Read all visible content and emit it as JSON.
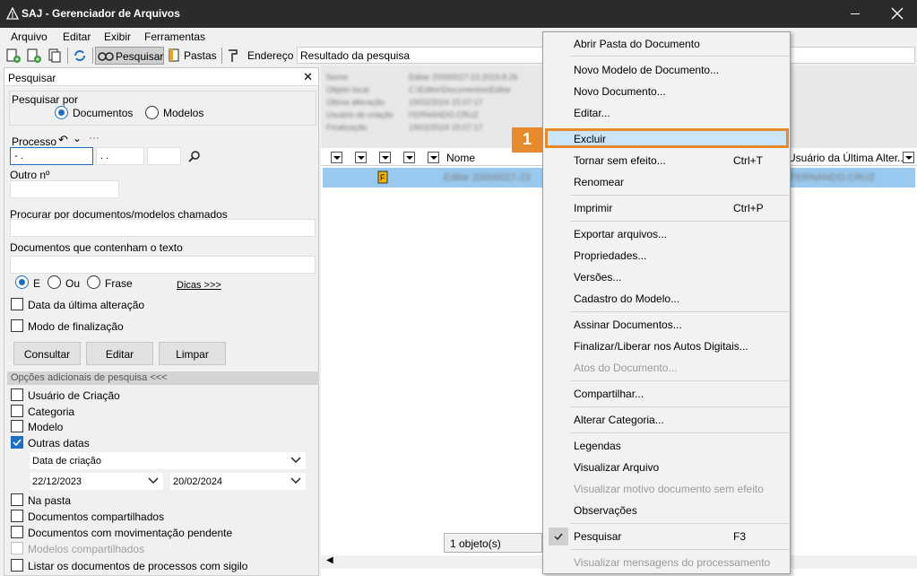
{
  "window": {
    "title": "SAJ - Gerenciador de Arquivos"
  },
  "menubar": [
    "Arquivo",
    "Editar",
    "Exibir",
    "Ferramentas"
  ],
  "toolbar": {
    "pesquisar": "Pesquisar",
    "pastas": "Pastas",
    "endereco_label": "Endereço",
    "endereco_value": "Resultado da pesquisa"
  },
  "left": {
    "header": "Pesquisar",
    "pesquisar_por": "Pesquisar por",
    "opt_documentos": "Documentos",
    "opt_modelos": "Modelos",
    "processo_label": "Processo",
    "processo_part1": "- .",
    "processo_part2": ". .",
    "outro_label": "Outro nº",
    "procurar_label": "Procurar por documentos/modelos chamados",
    "contenham_label": "Documentos que contenham o texto",
    "opt_e": "E",
    "opt_ou": "Ou",
    "opt_frase": "Frase",
    "dicas": "Dicas >>>",
    "chk_data": "Data da última alteração",
    "chk_modo": "Modo de finalização",
    "btn_consultar": "Consultar",
    "btn_editar": "Editar",
    "btn_limpar": "Limpar",
    "opcoes_header": "Opções adicionais de pesquisa <<<",
    "opcoes": [
      {
        "label": "Usuário de Criação",
        "checked": false,
        "disabled": false
      },
      {
        "label": "Categoria",
        "checked": false,
        "disabled": false
      },
      {
        "label": "Modelo",
        "checked": false,
        "disabled": false
      },
      {
        "label": "Outras datas",
        "checked": true,
        "disabled": false
      }
    ],
    "data_tipo": "Data de criação",
    "data_inicio": "22/12/2023",
    "data_fim": "20/02/2024",
    "opcoes2": [
      {
        "label": "Na pasta",
        "checked": false,
        "disabled": false
      },
      {
        "label": "Documentos compartilhados",
        "checked": false,
        "disabled": false
      },
      {
        "label": "Documentos com movimentação pendente",
        "checked": false,
        "disabled": false
      },
      {
        "label": "Modelos compartilhados",
        "checked": false,
        "disabled": true
      },
      {
        "label": "Listar os documentos de processos com sigilo",
        "checked": false,
        "disabled": false
      }
    ]
  },
  "right": {
    "col_nome": "Nome",
    "col_usuario": "Usuário da Última Alter...",
    "status": "1 objeto(s)"
  },
  "context_menu": {
    "items": [
      {
        "label": "Abrir Pasta do Documento",
        "shortcut": "",
        "disabled": false
      },
      {
        "label": "Novo Modelo de Documento...",
        "shortcut": "",
        "disabled": false
      },
      {
        "label": "Novo Documento...",
        "shortcut": "",
        "disabled": false
      },
      {
        "label": "Editar...",
        "shortcut": "",
        "disabled": false
      },
      {
        "label": "Excluir",
        "shortcut": "",
        "disabled": false
      },
      {
        "label": "Tornar sem efeito...",
        "shortcut": "Ctrl+T",
        "disabled": false
      },
      {
        "label": "Renomear",
        "shortcut": "",
        "disabled": false
      },
      {
        "label": "Imprimir",
        "shortcut": "Ctrl+P",
        "disabled": false
      },
      {
        "label": "Exportar arquivos...",
        "shortcut": "",
        "disabled": false
      },
      {
        "label": "Propriedades...",
        "shortcut": "",
        "disabled": false
      },
      {
        "label": "Versões...",
        "shortcut": "",
        "disabled": false
      },
      {
        "label": "Cadastro do Modelo...",
        "shortcut": "",
        "disabled": false
      },
      {
        "label": "Assinar Documentos...",
        "shortcut": "",
        "disabled": false
      },
      {
        "label": "Finalizar/Liberar nos Autos Digitais...",
        "shortcut": "",
        "disabled": false
      },
      {
        "label": "Atos do Documento...",
        "shortcut": "",
        "disabled": true
      },
      {
        "label": "Compartilhar...",
        "shortcut": "",
        "disabled": false
      },
      {
        "label": "Alterar Categoria...",
        "shortcut": "",
        "disabled": false
      },
      {
        "label": "Legendas",
        "shortcut": "",
        "disabled": false
      },
      {
        "label": "Visualizar Arquivo",
        "shortcut": "",
        "disabled": false
      },
      {
        "label": "Visualizar motivo documento sem efeito",
        "shortcut": "",
        "disabled": true
      },
      {
        "label": "Observações",
        "shortcut": "",
        "disabled": false
      },
      {
        "label": "Pesquisar",
        "shortcut": "F3",
        "disabled": false
      },
      {
        "label": "Visualizar mensagens do processamento",
        "shortcut": "",
        "disabled": true
      }
    ],
    "callout": "1"
  },
  "colors": {
    "accent": "#1e6fc4",
    "highlight": "#e68a2e",
    "selection": "#99c9ef"
  }
}
